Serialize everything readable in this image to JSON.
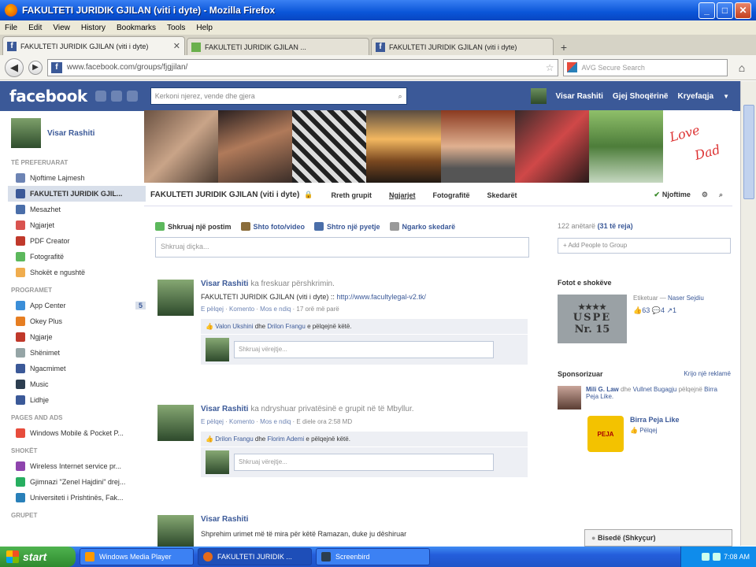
{
  "window": {
    "title": "FAKULTETI JURIDIK GJILAN (viti i dyte) - Mozilla Firefox",
    "minimize": "_",
    "maximize": "□",
    "close": "✕"
  },
  "menu": [
    "File",
    "Edit",
    "View",
    "History",
    "Bookmarks",
    "Tools",
    "Help"
  ],
  "tabs": [
    {
      "label": "FAKULTETI JURIDIK GJILAN (viti i dyte)",
      "icon": "facebook-icon",
      "active": true
    },
    {
      "label": "FAKULTETI JURIDIK GJILAN ...",
      "icon": "green-site-icon",
      "active": false
    },
    {
      "label": "FAKULTETI JURIDIK GJILAN (viti i dyte)",
      "icon": "facebook-icon",
      "active": false
    }
  ],
  "new_tab": "+",
  "nav": {
    "url": "www.facebook.com/groups/fjgjilan/",
    "search_placeholder": "AVG Secure Search"
  },
  "fb": {
    "logo": "facebook",
    "search_placeholder": "Kerkoni njerez, vende dhe gjera",
    "user": "Visar Rashiti",
    "find_friends": "Gjej Shoqërinë",
    "home": "Kryefaqja",
    "account_caret": "▼"
  },
  "sidebar": {
    "user": "Visar Rashiti",
    "favorites_heading": "TË PREFERUARAT",
    "favorites": [
      {
        "label": "Njoftime Lajmesh",
        "color": "#6d84b4"
      },
      {
        "label": "FAKULTETI JURIDIK GJIL...",
        "color": "#3b5998",
        "selected": true
      },
      {
        "label": "Mesazhet",
        "color": "#4a6ea9"
      },
      {
        "label": "Ngjarjet",
        "color": "#d9534f"
      },
      {
        "label": "PDF Creator",
        "color": "#c0392b"
      },
      {
        "label": "Fotografitë",
        "color": "#5cb85c"
      },
      {
        "label": "Shokët e ngushtë",
        "color": "#f0ad4e"
      }
    ],
    "apps_heading": "PROGRAMET",
    "apps": [
      {
        "label": "App Center",
        "color": "#3b8ed8",
        "badge": "5"
      },
      {
        "label": "Okey Plus",
        "color": "#e67e22"
      },
      {
        "label": "Ngjarje",
        "color": "#c0392b"
      },
      {
        "label": "Shënimet",
        "color": "#95a5a6"
      },
      {
        "label": "Ngacmimet",
        "color": "#3b5998"
      },
      {
        "label": "Music",
        "color": "#2c3e50"
      },
      {
        "label": "Lidhje",
        "color": "#3b5998"
      }
    ],
    "pages_heading": "PAGES AND ADS",
    "pages": [
      {
        "label": "Windows Mobile & Pocket P...",
        "color": "#e74c3c"
      }
    ],
    "friends_heading": "SHOKËT",
    "friends": [
      {
        "label": "Wireless Internet service pr...",
        "color": "#8e44ad"
      },
      {
        "label": "Gjimnazi \"Zenel Hajdini\" drej...",
        "color": "#27ae60"
      },
      {
        "label": "Universiteti i Prishtinës, Fak...",
        "color": "#2980b9"
      }
    ],
    "groups_heading": "GRUPET"
  },
  "cover": {
    "note_line1": "Love",
    "note_line2": "Dad"
  },
  "group": {
    "name": "FAKULTETI JURIDIK GJILAN (viti i dyte)",
    "lock": "🔒",
    "tabs": [
      "Rreth grupit",
      "Ngjarjet",
      "Fotografitë",
      "Skedarët"
    ],
    "notifications": "Njoftime",
    "settings_icon": "⚙",
    "search_icon": "🔍"
  },
  "composer": {
    "actions": [
      "Shkruaj një postim",
      "Shto foto/video",
      "Shtro një pyetje",
      "Ngarko skedarë"
    ],
    "placeholder": "Shkruaj diçka..."
  },
  "posts": [
    {
      "author": "Visar Rashiti",
      "action": "ka freskuar përshkrimin.",
      "text": "FAKULTETI JURIDIK GJILAN (viti i dyte) :: ",
      "link": "http://www.facultylegal-v2.tk/",
      "meta_like": "E pëlqej",
      "meta_comment": "Komento",
      "meta_follow": "Mos e ndiq",
      "meta_time": "17 orë më parë",
      "likes_name1": "Valon Ukshini",
      "likes_and": "dhe",
      "likes_name2": "Drilon Frangu",
      "likes_suffix": "e pëlqejnë këtë.",
      "comment_placeholder": "Shkruaj vërejtje..."
    },
    {
      "author": "Visar Rashiti",
      "action": "ka ndryshuar privatësinë e grupit në të Mbyllur.",
      "text": "",
      "link": "",
      "meta_like": "E pëlqej",
      "meta_comment": "Komento",
      "meta_follow": "Mos e ndiq",
      "meta_time": "E diele ora 2:58 MD",
      "likes_name1": "Drilon Frangu",
      "likes_and": "dhe",
      "likes_name2": "Florim Ademi",
      "likes_suffix": "e pëlqejnë këtë.",
      "comment_placeholder": "Shkruaj vërejtje..."
    },
    {
      "author": "Visar Rashiti",
      "action": "",
      "text": "Shprehim urimet më të mira për këtë Ramazan, duke ju dëshiruar"
    }
  ],
  "right": {
    "members_count": "122 anëtarë",
    "members_new": "(31 të reja)",
    "add_people": "+ Add People to Group",
    "friends_photos": "Fotot e shokëve",
    "photo_tag_prefix": "Etiketuar —",
    "photo_tag_name": "Naser Sejdiu",
    "photo_likes": "63",
    "photo_comments": "4",
    "photo_shares": "1",
    "photo_stars": "★★★★",
    "photo_line1": "USPE",
    "photo_line2": "Nr. 15",
    "sponsored": "Sponsorizuar",
    "create_ad": "Krijo një reklamë",
    "ad1_name": "Mili G. Law",
    "ad1_and": "dhe",
    "ad1_other": "Vullnet Bugagju",
    "ad1_likes": "pëlqejnë",
    "ad1_page": "Birra Peja Like.",
    "ad2_name": "Birra Peja Like",
    "ad2_like": "Pëlqej",
    "ad2_logo": "PEJA"
  },
  "chat": "Bisedë (Shkyçur)",
  "taskbar": {
    "start": "start",
    "items": [
      "Windows Media Player",
      "FAKULTETI JURIDIK ...",
      "Screenbird"
    ],
    "time": "7:08 AM"
  }
}
